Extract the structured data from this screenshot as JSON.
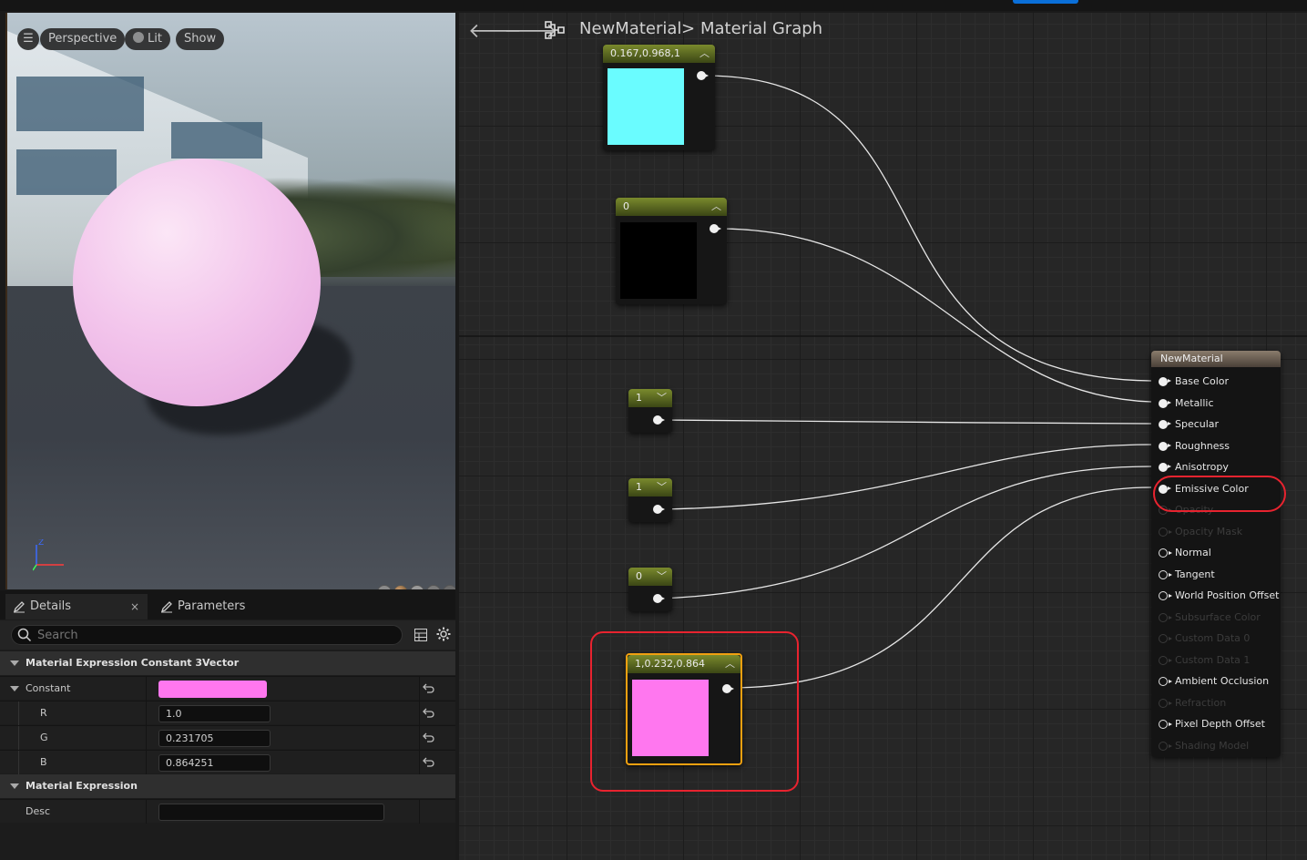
{
  "viewport": {
    "perspective_label": "Perspective",
    "lit_label": "Lit",
    "show_label": "Show",
    "axis_z": "Z"
  },
  "details_panel": {
    "tabs": [
      {
        "label": "Details",
        "close": "×"
      },
      {
        "label": "Parameters"
      }
    ],
    "search_placeholder": "Search",
    "categories": [
      {
        "label": "Material Expression Constant 3Vector",
        "properties": [
          {
            "label": "Constant",
            "type": "color",
            "value": "#ff77ef"
          },
          {
            "label": "R",
            "type": "number",
            "value": "1.0"
          },
          {
            "label": "G",
            "type": "number",
            "value": "0.231705"
          },
          {
            "label": "B",
            "type": "number",
            "value": "0.864251"
          }
        ]
      },
      {
        "label": "Material Expression",
        "properties": [
          {
            "label": "Desc",
            "type": "text",
            "value": ""
          }
        ]
      }
    ]
  },
  "graph": {
    "breadcrumb": {
      "asset": "NewMaterial",
      "separator": ">",
      "graph": "Material Graph"
    },
    "nodes": {
      "const_cyan": {
        "title": "0.167,0.968,1",
        "color": "#6afcff"
      },
      "const_black": {
        "title": "0",
        "color": "#000000"
      },
      "scalar_1a": {
        "title": "1"
      },
      "scalar_1b": {
        "title": "1"
      },
      "scalar_0": {
        "title": "0"
      },
      "const_pink": {
        "title": "1,0.232,0.864",
        "color": "#ff77ef"
      }
    },
    "material_node": {
      "title": "NewMaterial",
      "inputs": [
        {
          "label": "Base Color",
          "enabled": true,
          "connected": true
        },
        {
          "label": "Metallic",
          "enabled": true,
          "connected": true
        },
        {
          "label": "Specular",
          "enabled": true,
          "connected": true
        },
        {
          "label": "Roughness",
          "enabled": true,
          "connected": true
        },
        {
          "label": "Anisotropy",
          "enabled": true,
          "connected": true
        },
        {
          "label": "Emissive Color",
          "enabled": true,
          "connected": true
        },
        {
          "label": "Opacity",
          "enabled": false,
          "connected": false
        },
        {
          "label": "Opacity Mask",
          "enabled": false,
          "connected": false
        },
        {
          "label": "Normal",
          "enabled": true,
          "connected": false
        },
        {
          "label": "Tangent",
          "enabled": true,
          "connected": false
        },
        {
          "label": "World Position Offset",
          "enabled": true,
          "connected": false
        },
        {
          "label": "Subsurface Color",
          "enabled": false,
          "connected": false
        },
        {
          "label": "Custom Data 0",
          "enabled": false,
          "connected": false
        },
        {
          "label": "Custom Data 1",
          "enabled": false,
          "connected": false
        },
        {
          "label": "Ambient Occlusion",
          "enabled": true,
          "connected": false
        },
        {
          "label": "Refraction",
          "enabled": false,
          "connected": false
        },
        {
          "label": "Pixel Depth Offset",
          "enabled": true,
          "connected": false
        },
        {
          "label": "Shading Model",
          "enabled": false,
          "connected": false
        }
      ]
    },
    "highlight_color": "#e8232f"
  }
}
